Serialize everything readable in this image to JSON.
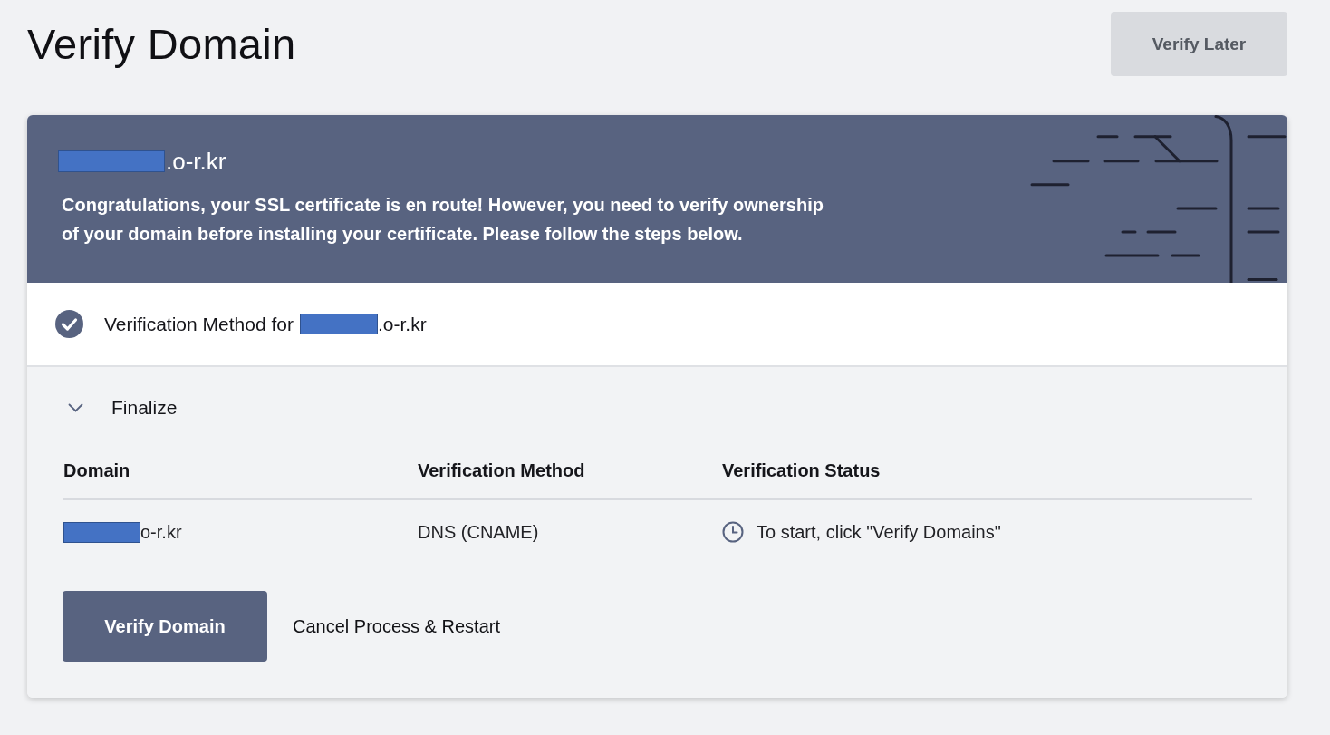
{
  "header": {
    "title": "Verify Domain",
    "action_button": "Verify Later"
  },
  "banner": {
    "domain": {
      "redacted": true,
      "text": ".o-r.kr"
    },
    "message": "Congratulations, your SSL certificate is en route! However, you need to verify ownership of your domain before installing your certificate. Please follow the steps below."
  },
  "method_step": {
    "checked": true,
    "label": "Verification Method for",
    "domain": {
      "redacted": true,
      "text": ".o-r.kr"
    }
  },
  "finalize": {
    "title": "Finalize",
    "expanded": true,
    "table": {
      "columns": [
        "Domain",
        "Verification Method",
        "Verification Status"
      ],
      "rows": [
        {
          "domain": {
            "redacted": true,
            "text": "o-r.kr"
          },
          "method": "DNS (CNAME)",
          "status": "To start, click \"Verify Domains\""
        }
      ]
    },
    "buttons": [
      {
        "kind": "primary",
        "label": "Verify Domain"
      },
      {
        "kind": "link",
        "label": "Cancel Process & Restart"
      }
    ]
  }
}
